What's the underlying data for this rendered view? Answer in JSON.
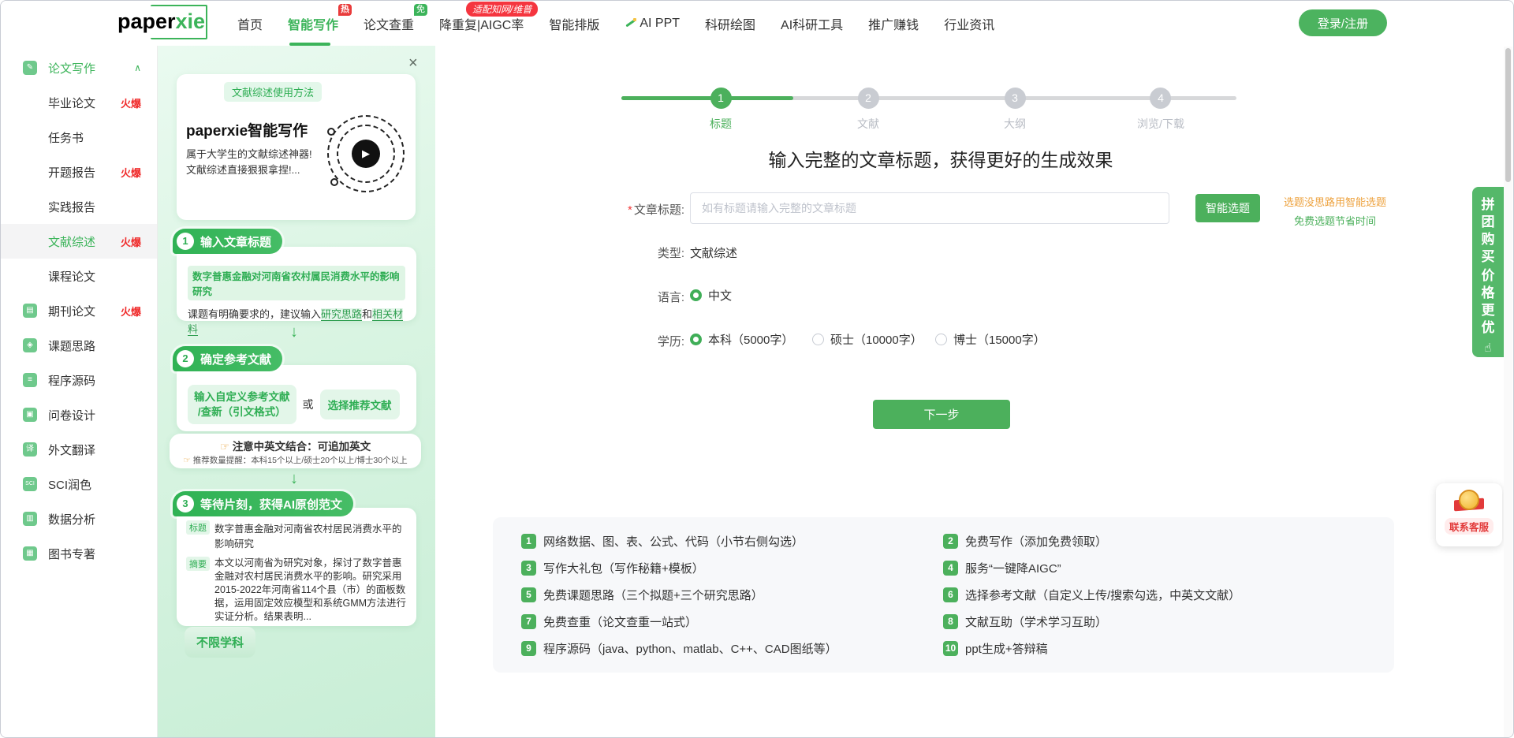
{
  "colors": {
    "accent_green": "#4cb05c",
    "nav_green": "#3cb45a",
    "badge_red": "#e93b3b",
    "pill_red": "#f5353f",
    "hot_red": "#f02c2c",
    "hint_orange": "#eda23e",
    "panel_green_bg": "#d9f4e2",
    "feature_bg": "#f7f8fa"
  },
  "brand": {
    "logo_black": "paper",
    "logo_green": "xie"
  },
  "nav": {
    "items": [
      {
        "label": "首页"
      },
      {
        "label": "智能写作",
        "badge": "热"
      },
      {
        "label": "论文查重",
        "badge": "免"
      },
      {
        "label": "降重复|AIGC率",
        "top_badge": "适配知网/维普"
      },
      {
        "label": "智能排版"
      },
      {
        "label": "AI PPT"
      },
      {
        "label": "科研绘图"
      },
      {
        "label": "AI科研工具"
      },
      {
        "label": "推广赚钱"
      },
      {
        "label": "行业资讯"
      }
    ],
    "login_button": "登录/注册"
  },
  "sidebar": {
    "items": [
      {
        "label": "论文写作",
        "icon": "✎",
        "chevron": "∧"
      },
      {
        "label": "毕业论文",
        "hot": "火爆"
      },
      {
        "label": "任务书"
      },
      {
        "label": "开题报告",
        "hot": "火爆"
      },
      {
        "label": "实践报告"
      },
      {
        "label": "文献综述",
        "hot": "火爆"
      },
      {
        "label": "课程论文"
      },
      {
        "label": "期刊论文",
        "icon": "▤",
        "hot": "火爆"
      },
      {
        "label": "课题思路",
        "icon": "◈"
      },
      {
        "label": "程序源码",
        "icon": "≡"
      },
      {
        "label": "问卷设计",
        "icon": "▣"
      },
      {
        "label": "外文翻译",
        "icon": "译"
      },
      {
        "label": "SCI润色",
        "icon": "SCI"
      },
      {
        "label": "数据分析",
        "icon": "▥"
      },
      {
        "label": "图书专著",
        "icon": "▦"
      }
    ]
  },
  "promo": {
    "close_icon": "×",
    "card": {
      "badge": "文献综述使用方法",
      "title": "paperxie智能写作",
      "desc1": "属于大学生的文献综述神器!",
      "desc2": "文献综述直接狠狠拿捏!...",
      "play_icon": "▶"
    },
    "step1": {
      "num": "1",
      "badge": "输入文章标题",
      "highlight": "数字普惠金融对河南省农村属民消费水平的影响研究",
      "note_prefix": "课题有明确要求的，建议输入",
      "note_link1": "研究思路",
      "note_mid": "和",
      "note_link2": "相关材料"
    },
    "arrow": "↓",
    "step2": {
      "num": "2",
      "badge": "确定参考文献",
      "option1_line1": "输入自定义参考文献",
      "option1_line2": "/查新（引文格式）",
      "or": "或",
      "option2": "选择推荐文献",
      "hand_icon": "☞",
      "note1": "注意中英文结合：可追加英文",
      "note2": "推荐数量提醒：本科15个以上/硕士20个以上/博士30个以上"
    },
    "step3": {
      "num": "3",
      "badge": "等待片刻，获得AI原创范文",
      "title_tag": "标题",
      "title_text": "数字普惠金融对河南省农村居民消费水平的影响研究",
      "abstract_tag": "摘要",
      "abstract_text": "本文以河南省为研究对象，探讨了数字普惠金融对农村居民消费水平的影响。研究采用2015-2022年河南省114个县（市）的面板数据，运用固定效应模型和系统GMM方法进行实证分析。结果表明...",
      "subject_tag": "不限学科"
    }
  },
  "stepper": {
    "steps": [
      {
        "num": "1",
        "label": "标题"
      },
      {
        "num": "2",
        "label": "文献"
      },
      {
        "num": "3",
        "label": "大纲"
      },
      {
        "num": "4",
        "label": "浏览/下载"
      }
    ]
  },
  "main": {
    "title": "输入完整的文章标题，获得更好的生成效果",
    "form": {
      "required_mark": "*",
      "title_label": "文章标题:",
      "title_placeholder": "如有标题请输入完整的文章标题",
      "smart_topic_button": "智能选题",
      "hint_line1": "选题没思路用智能选题",
      "hint_line2": "免费选题节省时间",
      "type_label": "类型:",
      "type_value": "文献综述",
      "lang_label": "语言:",
      "lang_option": "中文",
      "degree_label": "学历:",
      "degree_option1": "本科（5000字）",
      "degree_option2": "硕士（10000字）",
      "degree_option3": "博士（15000字）",
      "next_button": "下一步"
    }
  },
  "features": {
    "items": [
      {
        "num": "1",
        "text": "网络数据、图、表、公式、代码（小节右侧勾选）"
      },
      {
        "num": "2",
        "text": "免费写作（添加免费领取）"
      },
      {
        "num": "3",
        "text": "写作大礼包（写作秘籍+模板）"
      },
      {
        "num": "4",
        "text": "服务“一键降AIGC”"
      },
      {
        "num": "5",
        "text": "免费课题思路（三个拟题+三个研究思路）"
      },
      {
        "num": "6",
        "text": "选择参考文献（自定义上传/搜索勾选，中英文文献）"
      },
      {
        "num": "7",
        "text": "免费查重（论文查重一站式）"
      },
      {
        "num": "8",
        "text": "文献互助（学术学习互助）"
      },
      {
        "num": "9",
        "text": "程序源码（java、python、matlab、C++、CAD图纸等）"
      },
      {
        "num": "10",
        "text": "ppt生成+答辩稿"
      }
    ]
  },
  "floats": {
    "groupbuy": {
      "line1": "拼团购买",
      "line2": "价格更优",
      "hand_icon": "☝"
    },
    "service": {
      "label": "联系客服"
    }
  }
}
